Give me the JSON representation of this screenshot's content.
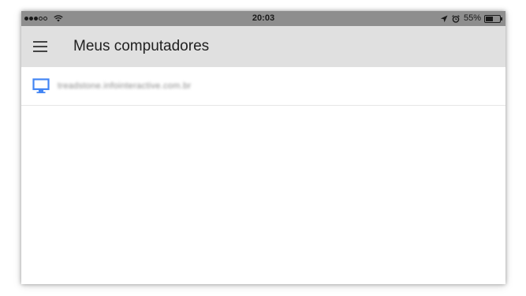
{
  "status_bar": {
    "signal_dots": [
      true,
      true,
      true,
      false,
      false
    ],
    "wifi_icon": "wifi-icon",
    "time": "20:03",
    "location_icon": "location-arrow-icon",
    "alarm_icon": "alarm-clock-icon",
    "battery_percent": "55%",
    "battery_level": 0.55,
    "background_color": "#8e8e8e"
  },
  "app_bar": {
    "menu_icon": "hamburger-menu-icon",
    "title": "Meus computadores",
    "background_color": "#e0e0e0"
  },
  "computers": [
    {
      "icon": "monitor-icon",
      "icon_color": "#4285f4",
      "name": "treadstone.infointeractive.com.br"
    }
  ]
}
